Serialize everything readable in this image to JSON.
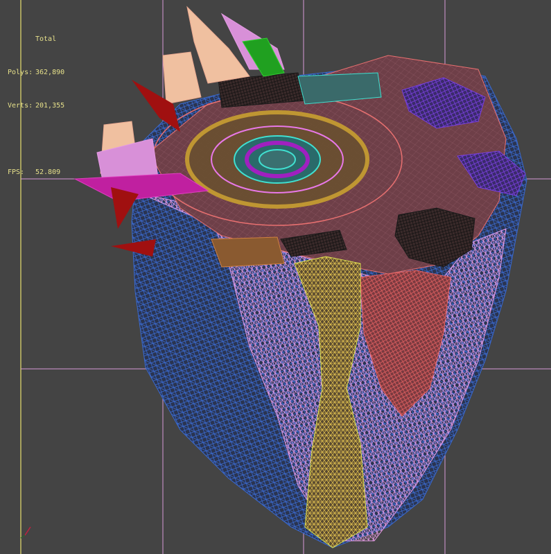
{
  "viewport": {
    "stats": {
      "title": "Total",
      "polys_label": "Polys:",
      "polys_value": "362,890",
      "verts_label": "Verts:",
      "verts_value": "201,355",
      "fps_label": "FPS:",
      "fps_value": "52.809"
    },
    "colors": {
      "background": "#444444",
      "stats_text": "#e6e08a",
      "grid_major": "#e8e070",
      "grid_minor": "#d89ad8"
    }
  }
}
